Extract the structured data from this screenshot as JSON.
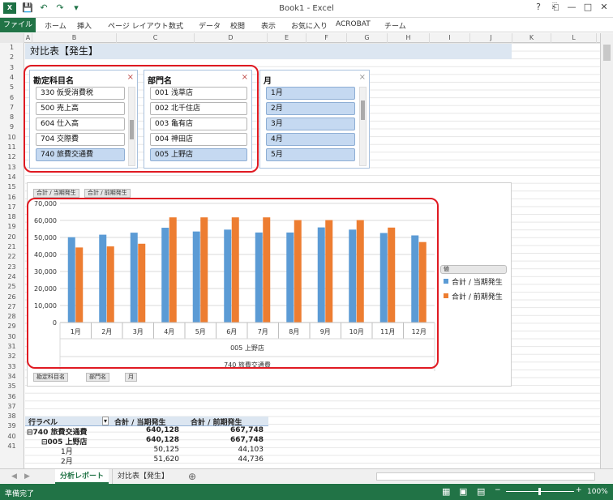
{
  "window": {
    "title": "Book1 - Excel",
    "help": "?",
    "min": "—",
    "max": "□",
    "close": "✕"
  },
  "ribbon_tabs": [
    "ファイル",
    "ホーム",
    "挿入",
    "ページ レイアウト",
    "数式",
    "データ",
    "校閲",
    "表示",
    "お気に入り",
    "ACROBAT",
    "チーム"
  ],
  "columns": [
    "A",
    "B",
    "C",
    "D",
    "E",
    "F",
    "G",
    "H",
    "I",
    "J",
    "K",
    "L"
  ],
  "rows": [
    "1",
    "2",
    "3",
    "4",
    "5",
    "6",
    "7",
    "8",
    "9",
    "10",
    "11",
    "12",
    "13",
    "14",
    "15",
    "16",
    "17",
    "18",
    "19",
    "20",
    "21",
    "22",
    "23",
    "24",
    "25",
    "26",
    "27",
    "28",
    "29",
    "30",
    "31",
    "32",
    "33",
    "34",
    "35",
    "36",
    "37",
    "38",
    "39",
    "40",
    "41"
  ],
  "sheet_title": "対比表【発生】",
  "slicers": [
    {
      "header": "勘定科目名",
      "items": [
        {
          "label": "330 仮受消費税",
          "selected": false
        },
        {
          "label": "500 売上高",
          "selected": false
        },
        {
          "label": "604 仕入高",
          "selected": false
        },
        {
          "label": "704 交際費",
          "selected": false
        },
        {
          "label": "740 旅費交通費",
          "selected": true
        }
      ]
    },
    {
      "header": "部門名",
      "items": [
        {
          "label": "001 浅草店",
          "selected": false
        },
        {
          "label": "002 北千住店",
          "selected": false
        },
        {
          "label": "003 亀有店",
          "selected": false
        },
        {
          "label": "004 神田店",
          "selected": false
        },
        {
          "label": "005 上野店",
          "selected": true
        }
      ]
    },
    {
      "header": "月",
      "items": [
        {
          "label": "1月",
          "selected": true
        },
        {
          "label": "2月",
          "selected": true
        },
        {
          "label": "3月",
          "selected": true
        },
        {
          "label": "4月",
          "selected": true
        },
        {
          "label": "5月",
          "selected": true
        }
      ]
    }
  ],
  "chart": {
    "value_buttons": [
      "合計 / 当期発生",
      "合計 / 前期発生"
    ],
    "axis_buttons": [
      "勘定科目名",
      "部門名",
      "月"
    ],
    "legend_header": "値"
  },
  "chart_data": {
    "type": "bar",
    "categories": [
      "1月",
      "2月",
      "3月",
      "4月",
      "5月",
      "6月",
      "7月",
      "8月",
      "9月",
      "10月",
      "11月",
      "12月"
    ],
    "series": [
      {
        "name": "合計 / 当期発生",
        "color": "#5b9bd5",
        "values": [
          50125,
          51620,
          52800,
          55700,
          53500,
          54600,
          52900,
          52900,
          55900,
          54600,
          52600,
          51200
        ]
      },
      {
        "name": "合計 / 前期発生",
        "color": "#ed7d31",
        "values": [
          44103,
          44736,
          46300,
          61800,
          61800,
          61800,
          61800,
          60200,
          60200,
          60200,
          55800,
          47300
        ]
      }
    ],
    "ylim": [
      0,
      70000
    ],
    "yticks": [
      "0",
      "10,000",
      "20,000",
      "30,000",
      "40,000",
      "50,000",
      "60,000",
      "70,000"
    ],
    "group_labels": [
      "005 上野店",
      "740 旅費交通費"
    ],
    "legend": "right",
    "grid": true
  },
  "pivot": {
    "headers": [
      "行ラベル",
      "合計 / 当期発生",
      "合計 / 前期発生"
    ],
    "rows": [
      {
        "label": "⊟740 旅費交通費",
        "v1": "640,128",
        "v2": "667,748",
        "bold": true,
        "indent": 0
      },
      {
        "label": "⊟005 上野店",
        "v1": "640,128",
        "v2": "667,748",
        "bold": true,
        "indent": 1
      },
      {
        "label": "1月",
        "v1": "50,125",
        "v2": "44,103",
        "bold": false,
        "indent": 2
      },
      {
        "label": "2月",
        "v1": "51,620",
        "v2": "44,736",
        "bold": false,
        "indent": 2
      }
    ]
  },
  "sheet_tabs": [
    "分析レポート",
    "対比表【発生】"
  ],
  "status": {
    "ready": "準備完了",
    "zoom": "100%"
  }
}
